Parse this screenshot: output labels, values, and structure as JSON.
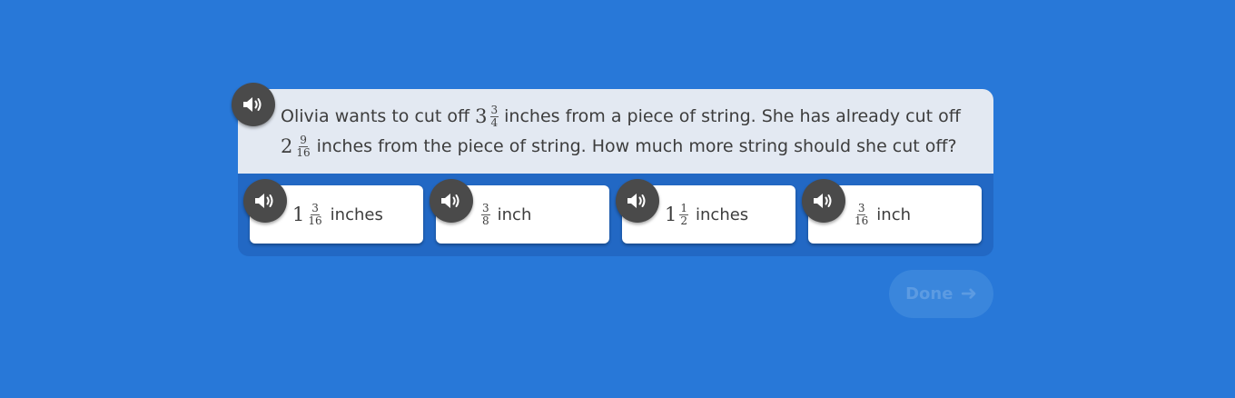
{
  "question": {
    "line1_a": "Olivia wants to cut off",
    "q1_whole": "3",
    "q1_num": "3",
    "q1_den": "4",
    "line1_b": "inches from a piece of string. She has already cut off",
    "q2_whole": "2",
    "q2_num": "9",
    "q2_den": "16",
    "line2_b": "inches from the piece of string. How much more string should she cut off?"
  },
  "choices": [
    {
      "whole": "1",
      "num": "3",
      "den": "16",
      "unit": "inches"
    },
    {
      "whole": "",
      "num": "3",
      "den": "8",
      "unit": "inch"
    },
    {
      "whole": "1",
      "num": "1",
      "den": "2",
      "unit": "inches"
    },
    {
      "whole": "",
      "num": "3",
      "den": "16",
      "unit": "inch"
    }
  ],
  "done_label": "Done",
  "icons": {
    "speaker": "speaker-icon",
    "arrow": "arrow-right-icon"
  },
  "colors": {
    "background": "#2878d8",
    "question_bg": "#e3e9f2",
    "speaker": "#4a4a4a"
  }
}
